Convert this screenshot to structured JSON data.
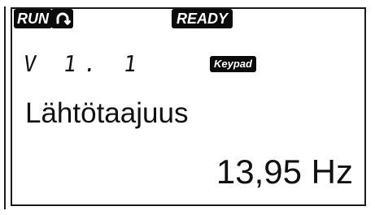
{
  "status": {
    "run_label": "RUN",
    "ready_label": "READY",
    "mode_label": "Keypad"
  },
  "icons": {
    "loop": "loop-arrow-icon"
  },
  "parameter": {
    "code": "V 1. 1",
    "name": "Lähtötaajuus",
    "value": "13,95 Hz"
  },
  "colors": {
    "foreground": "#0b0b0b",
    "background": "#ffffff"
  }
}
